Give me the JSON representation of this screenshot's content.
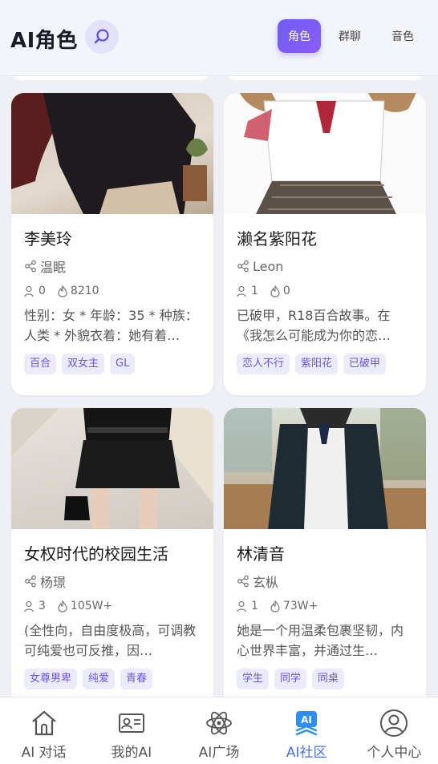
{
  "header": {
    "title": "AI角色",
    "tabs": [
      {
        "label": "角色",
        "active": true
      },
      {
        "label": "群聊",
        "active": false
      },
      {
        "label": "音色",
        "active": false
      }
    ]
  },
  "cards": [
    {
      "name": "李美玲",
      "author": "温眠",
      "users": "0",
      "heat": "8210",
      "description": "性别：女 * 年龄：35 * 种族：人类 * 外貌衣着：她有着…",
      "tags": [
        "百合",
        "双女主",
        "GL"
      ]
    },
    {
      "name": "濑名紫阳花",
      "author": "Leon",
      "users": "1",
      "heat": "0",
      "description": "已破甲，R18百合故事。在《我怎么可能成为你的恋…",
      "tags": [
        "恋人不行",
        "紫阳花",
        "已破甲"
      ]
    },
    {
      "name": "女权时代的校园生活",
      "author": "杨璟",
      "users": "3",
      "heat": "105W+",
      "description": "(全性向，自由度极高，可调教可纯爱也可反推，因…",
      "tags": [
        "女尊男卑",
        "纯爱",
        "青春"
      ]
    },
    {
      "name": "林清音",
      "author": "玄枞",
      "users": "1",
      "heat": "73W+",
      "description": "她是一个用温柔包裹坚韧，内心世界丰富，并通过生…",
      "tags": [
        "学生",
        "同学",
        "同桌"
      ]
    }
  ],
  "bottom_nav": [
    {
      "label": "AI 对话",
      "icon": "home-icon",
      "active": false
    },
    {
      "label": "我的AI",
      "icon": "id-card-icon",
      "active": false
    },
    {
      "label": "AI广场",
      "icon": "atom-icon",
      "active": false
    },
    {
      "label": "AI社区",
      "icon": "ai-community-icon",
      "active": true
    },
    {
      "label": "个人中心",
      "icon": "user-icon",
      "active": false
    }
  ],
  "colors": {
    "accent": "#6f5cf5",
    "nav_active": "#4a6ef0",
    "tag_bg": "#ecebfb",
    "tag_text": "#6b56e0"
  }
}
